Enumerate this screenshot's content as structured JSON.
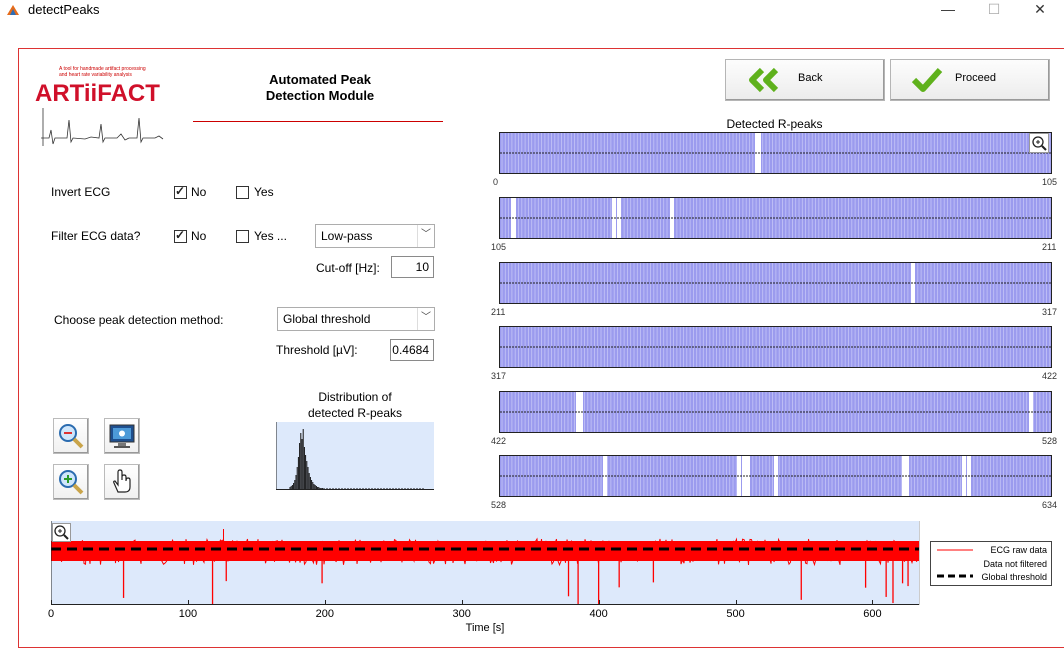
{
  "window": {
    "title": "detectPeaks",
    "minimize_glyph": "—",
    "maximize_glyph": "☐",
    "close_glyph": "✕"
  },
  "logo": {
    "tagline_1": "A tool for handmade artifact processing",
    "tagline_2": "and heart rate variability analysis",
    "name": "ARTiiFACT"
  },
  "module_title": {
    "line1": "Automated Peak",
    "line2": "Detection Module"
  },
  "buttons": {
    "back": "Back",
    "proceed": "Proceed"
  },
  "form": {
    "invert_ecg": {
      "label": "Invert ECG",
      "no": "No",
      "yes": "Yes",
      "selected": "No"
    },
    "filter_ecg": {
      "label": "Filter ECG data?",
      "no": "No",
      "yes": "Yes ...",
      "selected": "No"
    },
    "filter_type": {
      "value": "Low-pass"
    },
    "cutoff": {
      "label": "Cut-off [Hz]:",
      "value": "10"
    },
    "method": {
      "label": "Choose peak detection method:",
      "value": "Global threshold"
    },
    "threshold": {
      "label": "Threshold [µV]:",
      "value": "0.4684"
    }
  },
  "histogram": {
    "title_line1": "Distribution of",
    "title_line2": "detected R-peaks"
  },
  "strips": {
    "title": "Detected R-peaks",
    "rows": [
      {
        "start": "0",
        "end": "105"
      },
      {
        "start": "105",
        "end": "211"
      },
      {
        "start": "211",
        "end": "317"
      },
      {
        "start": "317",
        "end": "422"
      },
      {
        "start": "422",
        "end": "528"
      },
      {
        "start": "528",
        "end": "634"
      }
    ]
  },
  "colors": {
    "strip_fill": "#9b9bee",
    "signal": "#ff0000",
    "axes_bg": "#dde9fb",
    "accent": "#cc0000",
    "check_green": "#5fb11c"
  },
  "chart_data": {
    "type": "line",
    "xlabel": "Time [s]",
    "ylabel": "",
    "xlim": [
      0,
      634
    ],
    "x_ticks": [
      "0",
      "100",
      "200",
      "300",
      "400",
      "500",
      "600"
    ],
    "series": [
      {
        "name": "ECG raw data"
      },
      {
        "name": "Global threshold"
      }
    ],
    "legend": {
      "position": "right",
      "entries": [
        "ECG raw data",
        "Data not filtered",
        "Global threshold"
      ]
    },
    "downward_spikes_s": [
      53,
      118,
      128,
      198,
      378,
      385,
      400,
      415,
      440,
      548,
      595,
      610,
      615,
      622,
      626
    ]
  },
  "icons": {
    "zoom_out": "zoom-out-icon",
    "zoom_in": "zoom-in-icon",
    "monitor": "monitor-icon",
    "hand": "hand-icon",
    "magnifier": "magnifier-icon"
  }
}
